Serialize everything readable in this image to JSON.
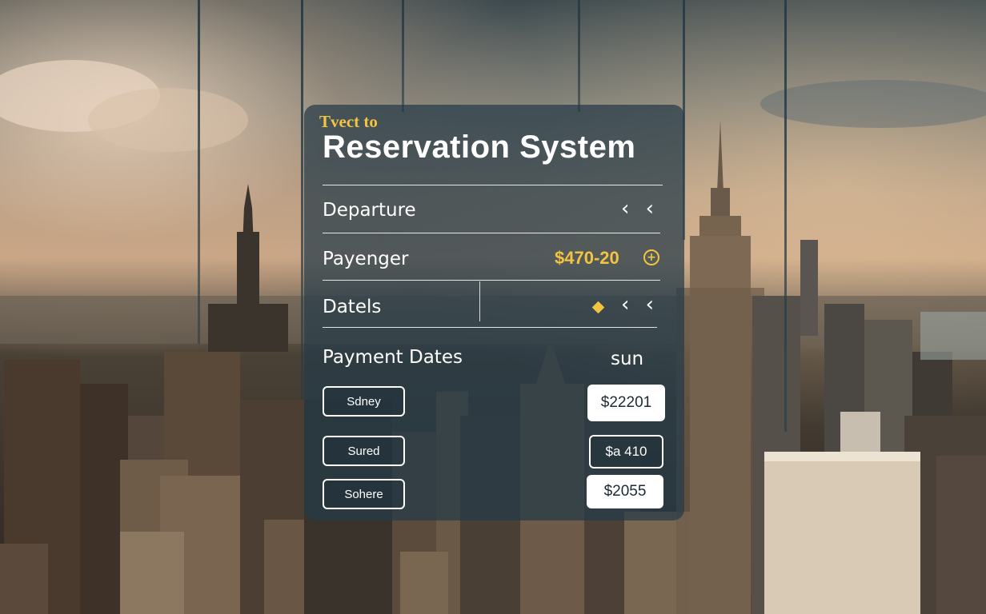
{
  "header": {
    "subtitle": "Tvect to",
    "title": "Reservation System"
  },
  "rows": {
    "departure": {
      "label": "Departure",
      "control": "‹ ‹"
    },
    "passenger": {
      "label": "Payenger",
      "value": "$470-20",
      "icon": "plus-circle-icon"
    },
    "dates": {
      "label": "Datels",
      "control": "‹ ‹",
      "marker": "diamond-icon"
    }
  },
  "payment": {
    "heading": "Payment Dates",
    "day": "sun",
    "buttons": [
      "Sdney",
      "Sured",
      "Sohere"
    ],
    "amounts": [
      "$22201",
      "$a 410",
      "$2055"
    ]
  },
  "colors": {
    "accent": "#f2c440",
    "panel": "#243a48",
    "text": "#ffffff"
  }
}
